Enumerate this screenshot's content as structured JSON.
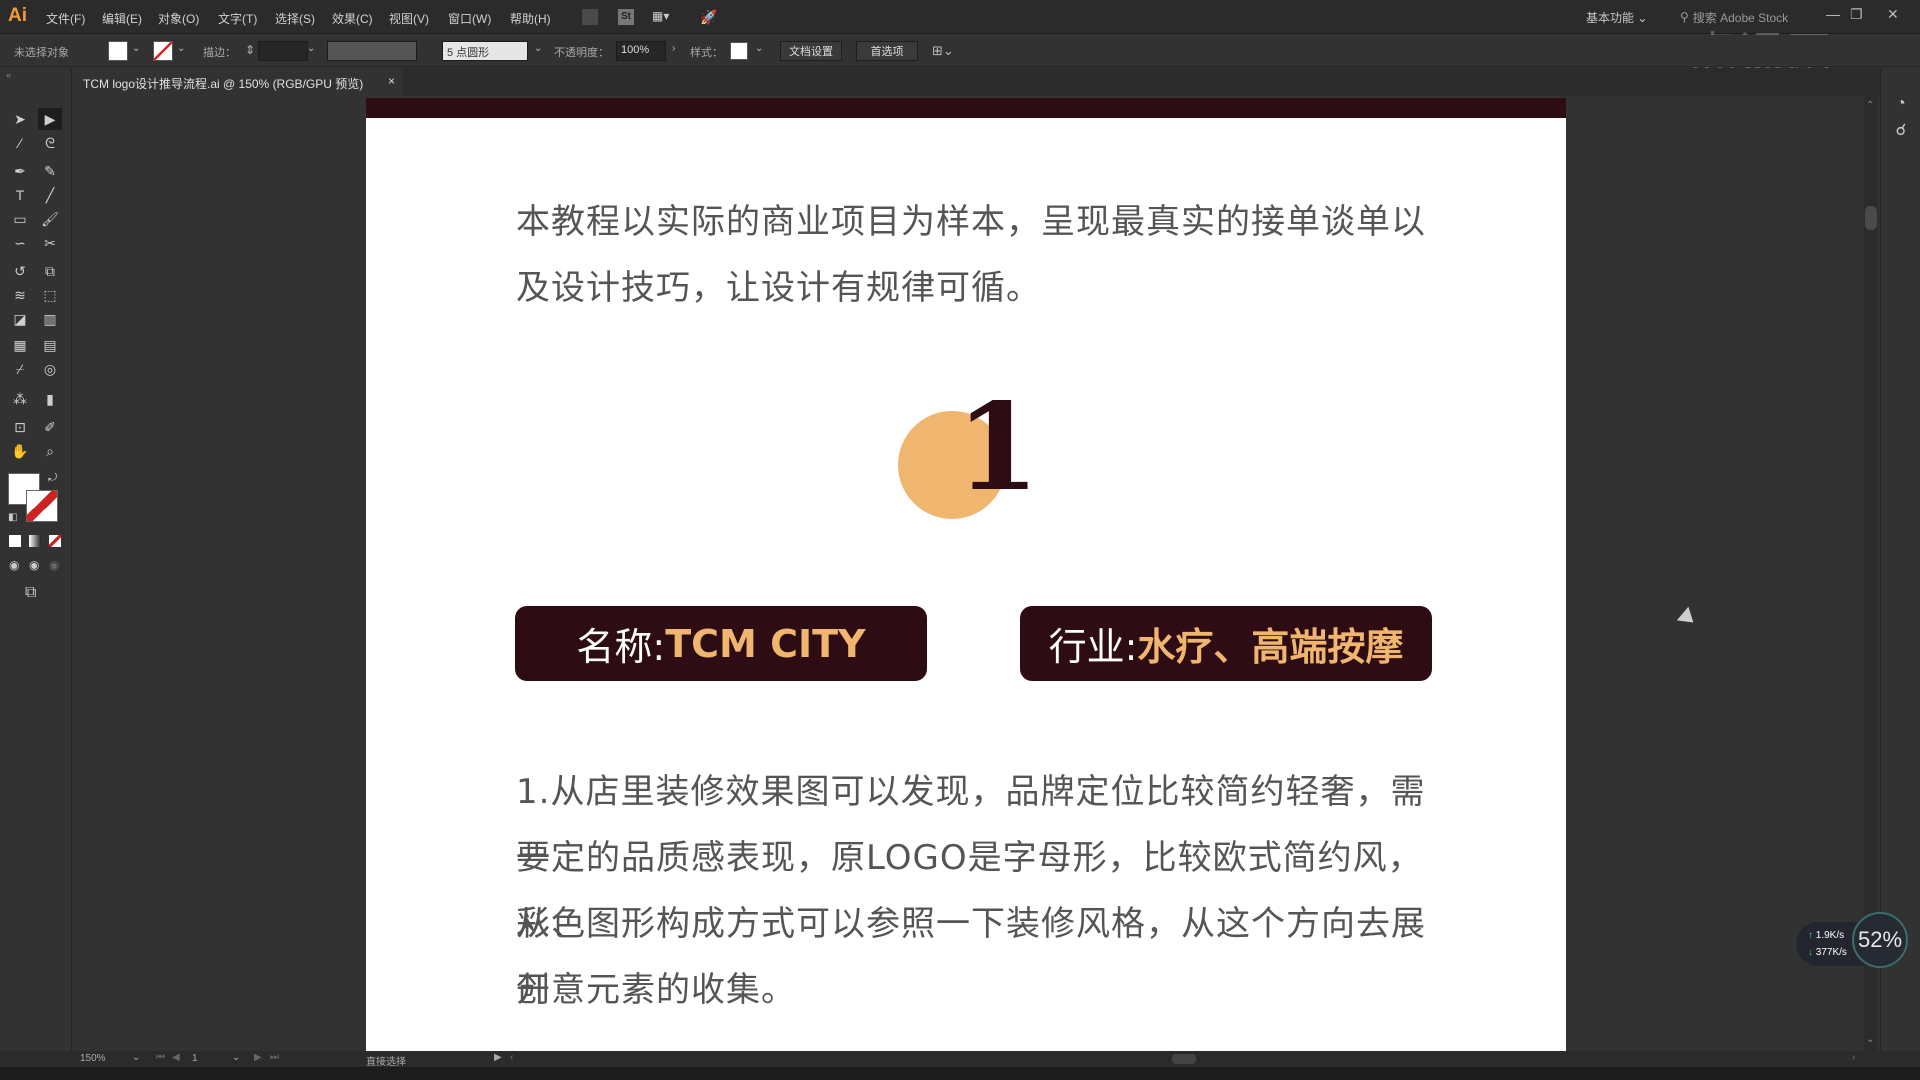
{
  "app": {
    "logo": "Ai",
    "menu": [
      "文件(F)",
      "编辑(E)",
      "对象(O)",
      "文字(T)",
      "选择(S)",
      "效果(C)",
      "视图(V)",
      "窗口(W)",
      "帮助(H)"
    ],
    "workspace": "基本功能",
    "stock_search_placeholder": "搜索 Adobe Stock",
    "window_controls": {
      "minimize": "—",
      "restore": "❐",
      "close": "✕"
    }
  },
  "controlbar": {
    "selection_status": "未选择对象",
    "stroke_label": "描边：",
    "brush_preset": "5 点圆形",
    "opacity_label": "不透明度：",
    "opacity_value": "100%",
    "style_label": "样式：",
    "doc_setup_button": "文档设置",
    "preferences_button": "首选项"
  },
  "tab": {
    "title": "TCM logo设计推导流程.ai @ 150% (RGB/GPU 预览)",
    "close": "×"
  },
  "toolbar": {
    "tools": [
      {
        "name": "selection-tool",
        "glyph": "➤"
      },
      {
        "name": "direct-selection-tool",
        "glyph": "▶"
      },
      {
        "name": "magic-wand-tool",
        "glyph": "⁄"
      },
      {
        "name": "lasso-tool",
        "glyph": "ᘓ"
      },
      {
        "name": "pen-tool",
        "glyph": "✒"
      },
      {
        "name": "curvature-tool",
        "glyph": "✎"
      },
      {
        "name": "type-tool",
        "glyph": "T"
      },
      {
        "name": "line-segment-tool",
        "glyph": "╱"
      },
      {
        "name": "rectangle-tool",
        "glyph": "▭"
      },
      {
        "name": "paintbrush-tool",
        "glyph": "🖌"
      },
      {
        "name": "shaper-tool",
        "glyph": "∽"
      },
      {
        "name": "scissors-tool",
        "glyph": "✂"
      },
      {
        "name": "rotate-tool",
        "glyph": "↺"
      },
      {
        "name": "scale-tool",
        "glyph": "⧉"
      },
      {
        "name": "warp-tool",
        "glyph": "≋"
      },
      {
        "name": "free-transform-tool",
        "glyph": "⬚"
      },
      {
        "name": "shape-builder-tool",
        "glyph": "◪"
      },
      {
        "name": "perspective-grid-tool",
        "glyph": "▥"
      },
      {
        "name": "mesh-tool",
        "glyph": "▦"
      },
      {
        "name": "gradient-tool",
        "glyph": "▤"
      },
      {
        "name": "eyedropper-tool",
        "glyph": "⌿"
      },
      {
        "name": "blend-tool",
        "glyph": "◎"
      },
      {
        "name": "symbol-sprayer-tool",
        "glyph": "⁂"
      },
      {
        "name": "column-graph-tool",
        "glyph": "▮"
      },
      {
        "name": "artboard-tool",
        "glyph": "⊡"
      },
      {
        "name": "slice-tool",
        "glyph": "✐"
      },
      {
        "name": "hand-tool",
        "glyph": "✋"
      },
      {
        "name": "zoom-tool",
        "glyph": "⌕"
      }
    ]
  },
  "artboard": {
    "intro_line1": "本教程以实际的商业项目为样本，呈现最真实的接单谈单以",
    "intro_line2": "及设计技巧，让设计有规律可循。",
    "step_number": "1",
    "name_label": "名称:",
    "name_value": "TCM CITY",
    "industry_label": "行业:",
    "industry_value": "水疗、高端按摩",
    "para_lines": [
      "1.从店里装修效果图可以发现，品牌定位比较简约轻奢，需要",
      "一定的品质感表现，原LOGO是字母形，比较欧式简约风，从色",
      "彩、图形构成方式可以参照一下装修风格，从这个方向去展开",
      "创意元素的收集。"
    ],
    "colors": {
      "dark": "#2e0c13",
      "accent": "#f0b56e"
    }
  },
  "statusbar": {
    "zoom": "150%",
    "artboard_index": "1",
    "tool_status": "直接选择"
  },
  "net_widget": {
    "upload": "1.9K/s",
    "download": "377K/s",
    "percent": "52%"
  },
  "watermark": "虎课网"
}
